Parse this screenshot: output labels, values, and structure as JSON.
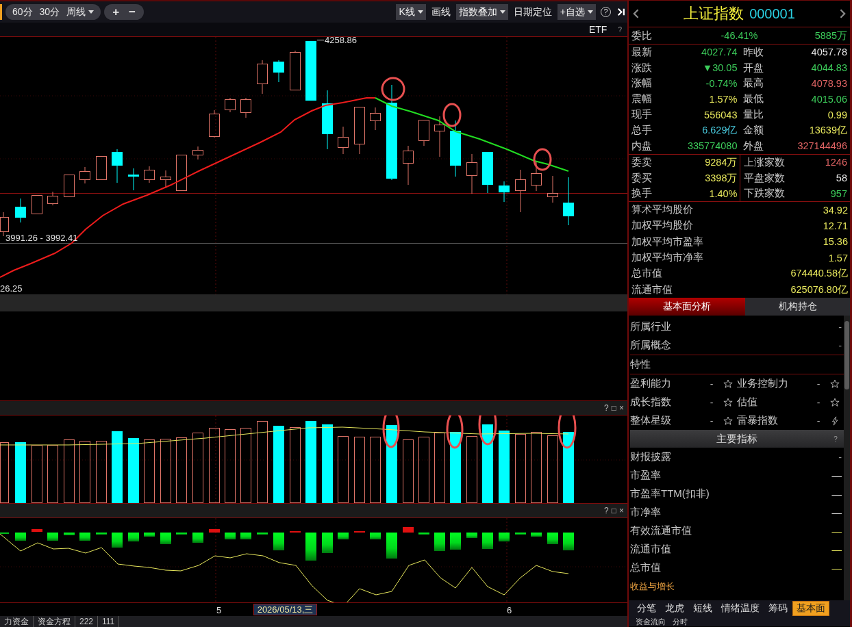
{
  "toolbar": {
    "periods": [
      {
        "label": "60分",
        "kind": "plain"
      },
      {
        "label": "30分",
        "kind": "plain"
      },
      {
        "label": "周线",
        "kind": "dropdown"
      }
    ],
    "zoom": [
      "+",
      "−"
    ],
    "tools": [
      {
        "label": "K线",
        "kind": "dropdown"
      },
      {
        "label": "画线",
        "kind": "plain"
      },
      {
        "label": "指数叠加",
        "kind": "dropdown"
      },
      {
        "label": "日期定位",
        "kind": "plain"
      },
      {
        "label": "+自选",
        "kind": "dropdown"
      }
    ],
    "help": "?"
  },
  "main_chart": {
    "indicator": "ETF",
    "help": "?",
    "high_label": "4258.86",
    "range_label": "3991.26 - 3992.41",
    "low_label": "26.25"
  },
  "volume_pane": {
    "controls": [
      "?",
      "□",
      "×"
    ]
  },
  "flow_pane": {
    "controls": [
      "?",
      "□",
      "×"
    ]
  },
  "x_axis": {
    "ticks": [
      "5",
      "6"
    ],
    "cursor_date": "2026/05/13,三"
  },
  "bottom_tabs": [
    "力资金",
    "资金方程",
    "222",
    "111"
  ],
  "quote": {
    "name": "上证指数",
    "code": "000001",
    "ratio": {
      "label": "委比",
      "value": "-46.41%",
      "amount": "5885万"
    },
    "stats": [
      {
        "label": "最新",
        "value": "4027.74",
        "color": "#3ccc5a"
      },
      {
        "label": "昨收",
        "value": "4057.78",
        "color": "#e6e6e6"
      },
      {
        "label": "涨跌",
        "value": "▼30.05",
        "color": "#3ccc5a"
      },
      {
        "label": "开盘",
        "value": "4044.83",
        "color": "#3ccc5a"
      },
      {
        "label": "涨幅",
        "value": "-0.74%",
        "color": "#3ccc5a"
      },
      {
        "label": "最高",
        "value": "4078.93",
        "color": "#e06464"
      },
      {
        "label": "震幅",
        "value": "1.57%",
        "color": "#e6e65c"
      },
      {
        "label": "最低",
        "value": "4015.06",
        "color": "#3ccc5a"
      },
      {
        "label": "现手",
        "value": "556043",
        "color": "#e6e65c"
      },
      {
        "label": "量比",
        "value": "0.99",
        "color": "#e6e65c"
      },
      {
        "label": "总手",
        "value": "6.629亿",
        "color": "#48c8dc"
      },
      {
        "label": "金额",
        "value": "13639亿",
        "color": "#e6e65c"
      },
      {
        "label": "内盘",
        "value": "335774080",
        "color": "#3ccc5a"
      },
      {
        "label": "外盘",
        "value": "327144496",
        "color": "#e06464"
      }
    ],
    "orders": [
      {
        "label": "委卖",
        "value": "9284万",
        "color": "#e6e65c"
      },
      {
        "label": "上涨家数",
        "value": "1246",
        "color": "#e06464"
      },
      {
        "label": "委买",
        "value": "3398万",
        "color": "#e6e65c"
      },
      {
        "label": "平盘家数",
        "value": "58",
        "color": "#e6e6e6"
      },
      {
        "label": "换手",
        "value": "1.40%",
        "color": "#e6e65c"
      },
      {
        "label": "下跌家数",
        "value": "957",
        "color": "#3ccc5a"
      }
    ],
    "averages": [
      {
        "label": "算术平均股价",
        "value": "34.92"
      },
      {
        "label": "加权平均股价",
        "value": "12.71"
      },
      {
        "label": "加权平均市盈率",
        "value": "15.36"
      },
      {
        "label": "加权平均市净率",
        "value": "1.57"
      },
      {
        "label": "总市值",
        "value": "674440.58亿"
      },
      {
        "label": "流通市值",
        "value": "625076.80亿"
      }
    ],
    "info_tabs": [
      {
        "label": "基本面分析",
        "selected": true
      },
      {
        "label": "机构持仓",
        "selected": false
      }
    ],
    "profile": [
      {
        "label": "所属行业",
        "value": "-"
      },
      {
        "label": "所属概念",
        "value": "-"
      }
    ],
    "traits_title": "特性",
    "traits": [
      {
        "label": "盈利能力",
        "value": "-",
        "kind": "rating"
      },
      {
        "label": "业务控制力",
        "value": "-",
        "kind": "rating"
      },
      {
        "label": "成长指数",
        "value": "-",
        "kind": "rating"
      },
      {
        "label": "估值",
        "value": "-",
        "kind": "rating"
      },
      {
        "label": "整体星级",
        "value": "-",
        "kind": "rating"
      },
      {
        "label": "雷暴指数",
        "value": "-",
        "kind": "alert"
      }
    ],
    "indicators_title": {
      "title": "主要指标",
      "help": "?"
    },
    "indicators": [
      {
        "label": "财报披露",
        "value": "-",
        "color": "#9a9a9a"
      },
      {
        "label": "市盈率",
        "value": "—",
        "color": "#e6e6e6"
      },
      {
        "label": "市盈率TTM(扣非)",
        "value": "—",
        "color": "#e6e6e6"
      },
      {
        "label": "市净率",
        "value": "—",
        "color": "#e6e6e6"
      },
      {
        "label": "有效流通市值",
        "value": "—",
        "color": "#e6e65c"
      },
      {
        "label": "流通市值",
        "value": "—",
        "color": "#e6e65c"
      },
      {
        "label": "总市值",
        "value": "—",
        "color": "#e6e65c"
      }
    ],
    "link": "收益与增长",
    "panel_tabs": [
      {
        "label": "分笔",
        "selected": false
      },
      {
        "label": "龙虎",
        "selected": false
      },
      {
        "label": "短线",
        "selected": false
      },
      {
        "label": "情绪温度",
        "selected": false
      },
      {
        "label": "筹码",
        "selected": false
      },
      {
        "label": "基本面",
        "selected": true
      }
    ],
    "panel_more": [
      "资金流向",
      "分时"
    ]
  }
}
